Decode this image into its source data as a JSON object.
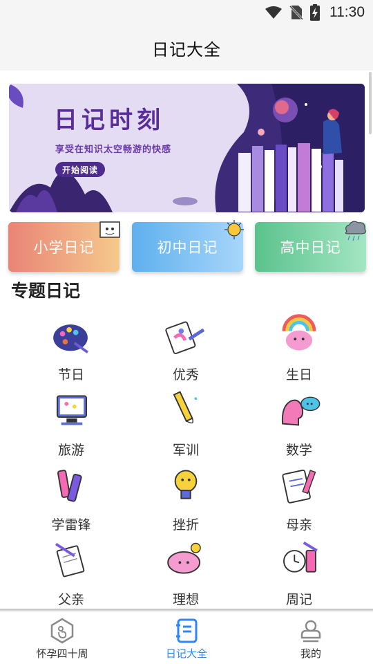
{
  "status_bar": {
    "time": "11:30",
    "icons": [
      "wifi-icon",
      "no-sim-icon",
      "battery-charging-icon"
    ]
  },
  "app_bar": {
    "title": "日记大全"
  },
  "banner": {
    "title": "日记时刻",
    "subtitle": "享受在知识太空畅游的快感",
    "button_label": "开始阅读"
  },
  "categories": [
    {
      "label": "小学日记",
      "color": "#e98477",
      "icon": "cat-sticker-icon"
    },
    {
      "label": "初中日记",
      "color": "#5fb0ee",
      "icon": "sun-sticker-icon"
    },
    {
      "label": "高中日记",
      "color": "#5bc28d",
      "icon": "cloud-sticker-icon"
    }
  ],
  "section": {
    "title": "专题日记"
  },
  "topics": [
    {
      "label": "节日",
      "icon": "palette-icon"
    },
    {
      "label": "优秀",
      "icon": "drawing-board-icon"
    },
    {
      "label": "生日",
      "icon": "brain-rainbow-icon"
    },
    {
      "label": "旅游",
      "icon": "computer-icon"
    },
    {
      "label": "军训",
      "icon": "pencil-icon"
    },
    {
      "label": "数学",
      "icon": "head-bubble-icon"
    },
    {
      "label": "学雷锋",
      "icon": "markers-icon"
    },
    {
      "label": "挫折",
      "icon": "lightbulb-icon"
    },
    {
      "label": "母亲",
      "icon": "notebook-icon"
    },
    {
      "label": "父亲",
      "icon": "notepad-icon"
    },
    {
      "label": "理想",
      "icon": "brain-idea-icon"
    },
    {
      "label": "周记",
      "icon": "alarm-clock-icon"
    }
  ],
  "bottom_nav": {
    "items": [
      {
        "label": "怀孕四十周",
        "icon": "pregnancy-icon"
      },
      {
        "label": "日记大全",
        "icon": "diary-icon"
      },
      {
        "label": "我的",
        "icon": "profile-icon"
      }
    ],
    "active_color": "#2f86f6"
  }
}
